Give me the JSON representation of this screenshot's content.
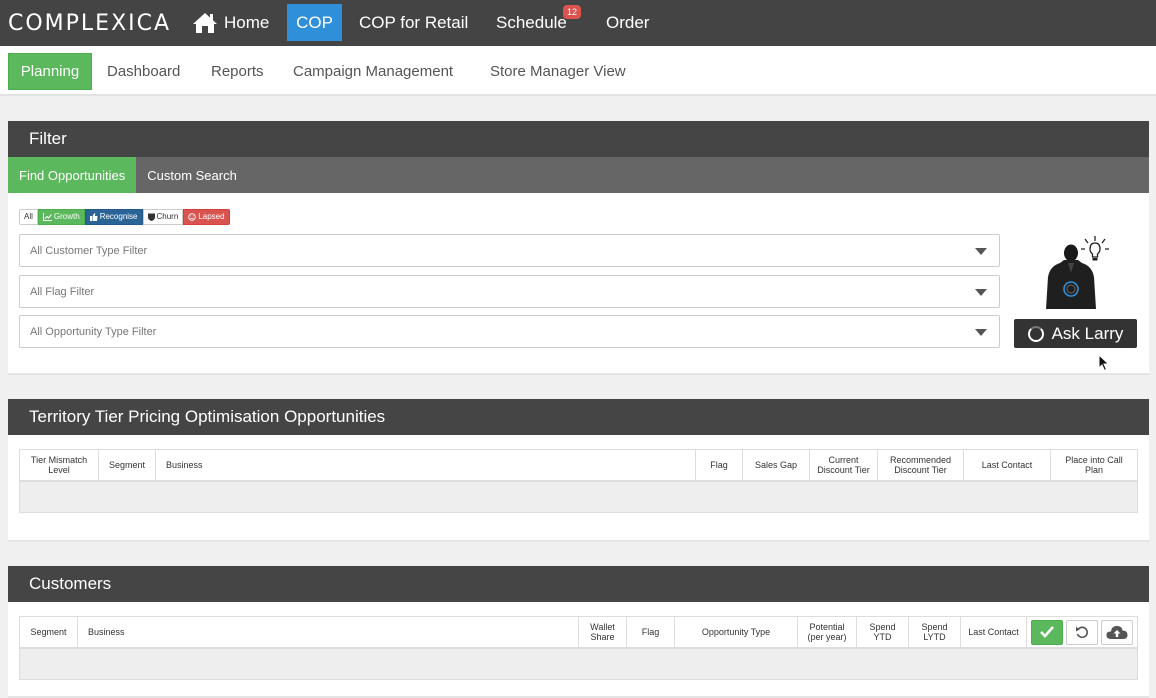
{
  "topnav": {
    "logo": "COMPLEXICA",
    "items": [
      {
        "label": "Home"
      },
      {
        "label": "COP"
      },
      {
        "label": "COP for Retail"
      },
      {
        "label": "Schedule",
        "badge": "12"
      },
      {
        "label": "Order"
      }
    ]
  },
  "subnav": {
    "items": [
      "Planning",
      "Dashboard",
      "Reports",
      "Campaign Management",
      "Store Manager View"
    ]
  },
  "filter": {
    "title": "Filter",
    "tabs": [
      "Find Opportunities",
      "Custom Search"
    ],
    "chips": [
      "All",
      "Growth",
      "Recognise",
      "Churn",
      "Lapsed"
    ],
    "selects": [
      "All Customer Type Filter",
      "All Flag Filter",
      "All Opportunity Type Filter"
    ],
    "ask_button": "Ask Larry"
  },
  "tier": {
    "title": "Territory Tier Pricing Optimisation Opportunities",
    "columns": [
      "Tier Mismatch Level",
      "Segment",
      "Business",
      "Flag",
      "Sales Gap",
      "Current Discount Tier",
      "Recommended Discount Tier",
      "Last Contact",
      "Place into Call Plan"
    ]
  },
  "customers": {
    "title": "Customers",
    "columns": [
      "Segment",
      "Business",
      "Wallet Share",
      "Flag",
      "Opportunity Type",
      "Potential (per year)",
      "Spend YTD",
      "Spend LYTD",
      "Last Contact"
    ]
  },
  "colors": {
    "nav_bg": "#444444",
    "green": "#5cb85c",
    "blue": "#2f8fd8",
    "red": "#d9534f"
  }
}
